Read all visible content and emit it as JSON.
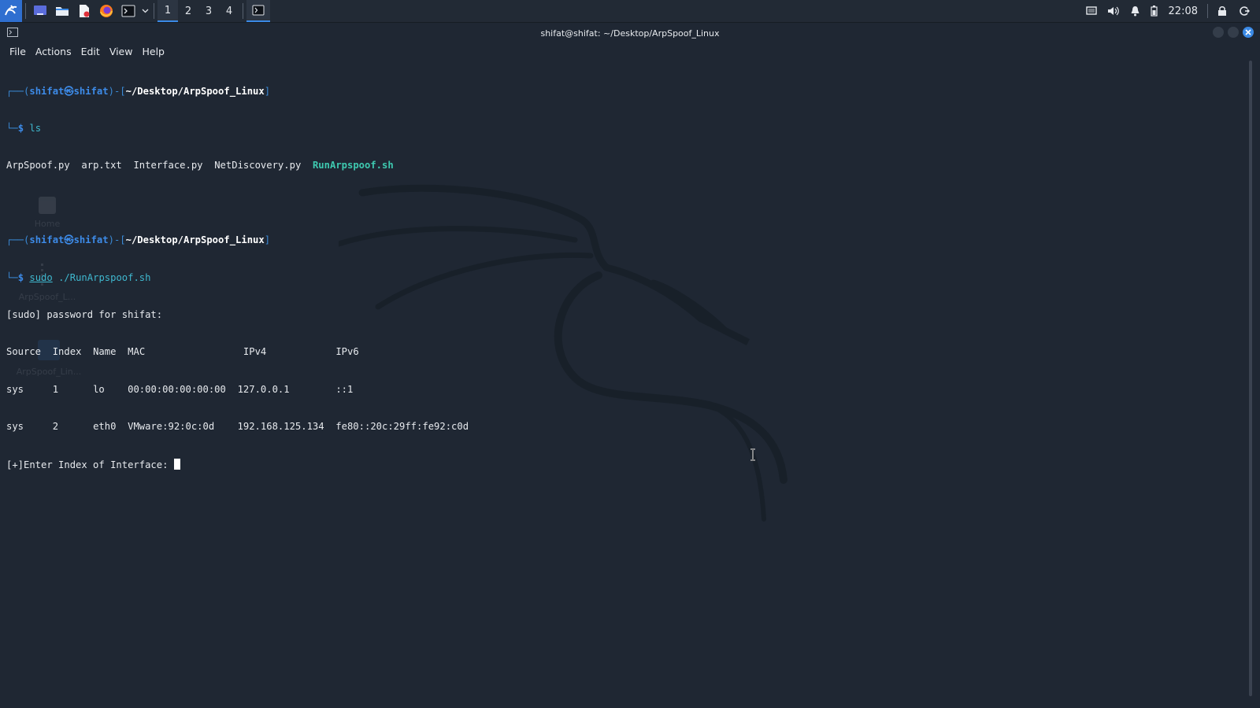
{
  "panel": {
    "workspaces": [
      "1",
      "2",
      "3",
      "4"
    ],
    "active_workspace": "1",
    "clock": "22:08"
  },
  "window": {
    "title": "shifat@shifat: ~/Desktop/ArpSpoof_Linux",
    "menu": [
      "File",
      "Actions",
      "Edit",
      "View",
      "Help"
    ]
  },
  "terminal": {
    "prompt1": {
      "user": "shifat㉿shifat",
      "path": "~/Desktop/ArpSpoof_Linux",
      "command": "ls"
    },
    "ls_output": [
      "ArpSpoof.py",
      "arp.txt",
      "Interface.py",
      "NetDiscovery.py",
      "RunArpspoof.sh"
    ],
    "prompt2": {
      "user": "shifat㉿shifat",
      "path": "~/Desktop/ArpSpoof_Linux",
      "command_sudo": "sudo",
      "command_rest": "./RunArpspoof.sh"
    },
    "sudo_prompt": "[sudo] password for shifat:",
    "table": {
      "headers": [
        "Source",
        "Index",
        "Name",
        "MAC",
        "IPv4",
        "IPv6"
      ],
      "rows": [
        [
          "sys",
          "1",
          "lo",
          "00:00:00:00:00:00",
          "127.0.0.1",
          "::1"
        ],
        [
          "sys",
          "2",
          "eth0",
          "VMware:92:0c:0d",
          "192.168.125.134",
          "fe80::20c:29ff:fe92:c0d"
        ]
      ]
    },
    "input_prompt": "[+]Enter Index of Interface: "
  },
  "desktop": {
    "icons": [
      "Home",
      "ArpSpoof_L...",
      "ArpSpoof_Lin..."
    ]
  },
  "colors": {
    "background": "#1f2733",
    "accent": "#3b8ae6",
    "executable": "#3ec9b0"
  }
}
